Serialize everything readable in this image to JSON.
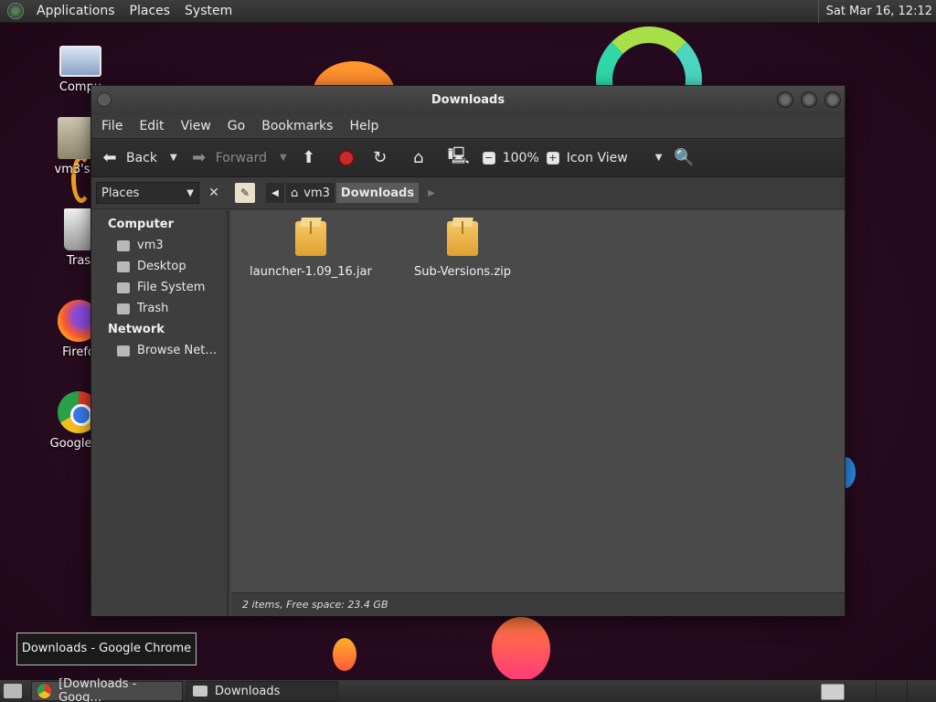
{
  "top_panel": {
    "menus": [
      "Applications",
      "Places",
      "System"
    ],
    "clock": "Sat Mar 16, 12:12"
  },
  "desktop_icons": [
    {
      "label": "Compu",
      "icon": "computer-icon"
    },
    {
      "label": "vm3's H",
      "icon": "home-folder-icon"
    },
    {
      "label": "Tras",
      "icon": "trash-icon"
    },
    {
      "label": "Firefo",
      "icon": "firefox-icon"
    },
    {
      "label": "Google Cl",
      "icon": "chrome-icon"
    }
  ],
  "window": {
    "title": "Downloads",
    "menu": [
      "File",
      "Edit",
      "View",
      "Go",
      "Bookmarks",
      "Help"
    ],
    "toolbar": {
      "back": "Back",
      "forward": "Forward",
      "zoom": "100%",
      "view_mode": "Icon View"
    },
    "location": {
      "places_label": "Places",
      "crumbs": [
        "vm3",
        "Downloads"
      ]
    },
    "sidebar": {
      "computer_heading": "Computer",
      "computer_items": [
        "vm3",
        "Desktop",
        "File System",
        "Trash"
      ],
      "network_heading": "Network",
      "network_items": [
        "Browse Net…"
      ]
    },
    "files": [
      {
        "name": "launcher-1.09_16.jar",
        "icon": "package-icon"
      },
      {
        "name": "Sub-Versions.zip",
        "icon": "package-icon"
      }
    ],
    "status": "2 items, Free space: 23.4 GB"
  },
  "tooltip": "Downloads - Google Chrome",
  "taskbar": {
    "tasks": [
      "[Downloads - Goog…",
      "Downloads"
    ]
  }
}
